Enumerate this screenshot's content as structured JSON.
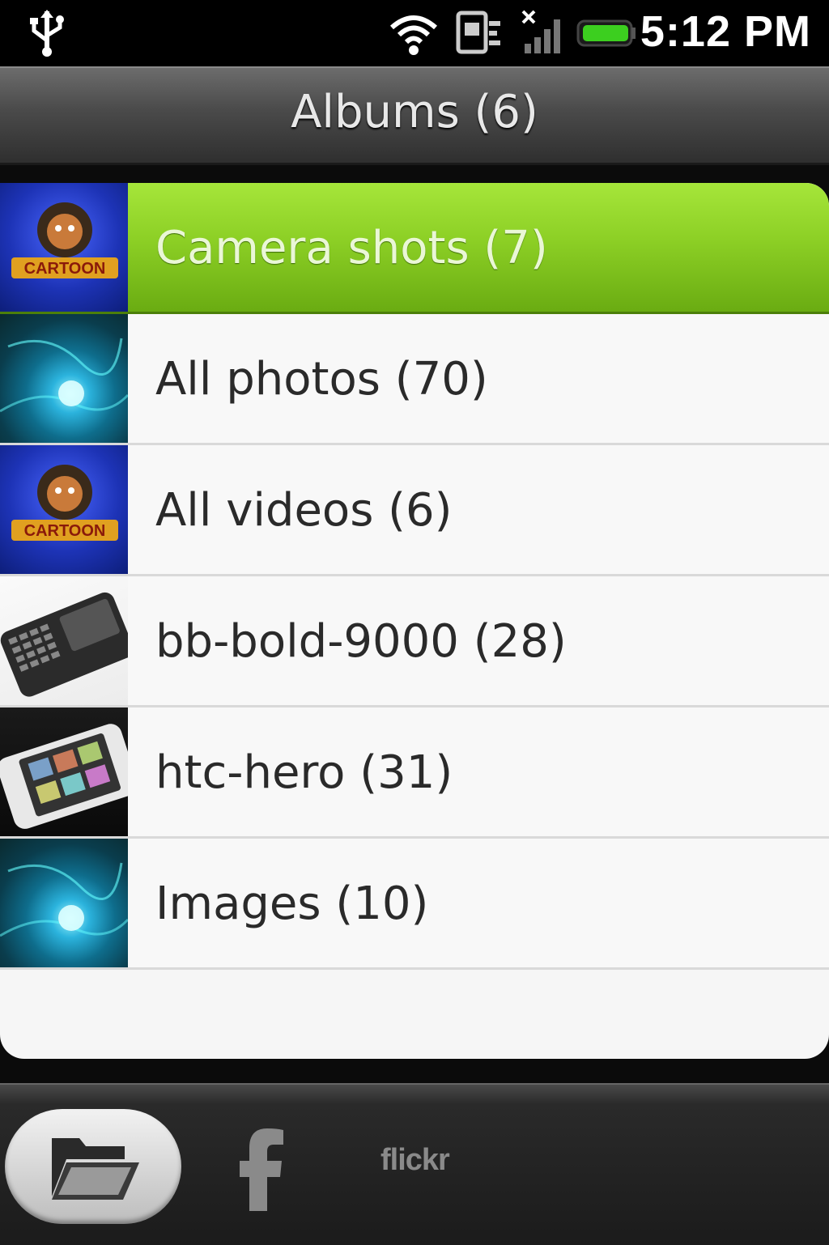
{
  "status_bar": {
    "time": "5:12 PM",
    "icons": [
      "usb-icon",
      "wifi-icon",
      "data-sync-icon",
      "signal-no-service-icon",
      "battery-icon"
    ]
  },
  "header": {
    "title": "Albums (6)"
  },
  "albums": [
    {
      "label": "Camera shots (7)",
      "thumbnail": "cartoon-thumbnail",
      "selected": true
    },
    {
      "label": "All photos (70)",
      "thumbnail": "tech-thumbnail",
      "selected": false
    },
    {
      "label": "All videos (6)",
      "thumbnail": "cartoon-thumbnail",
      "selected": false
    },
    {
      "label": "bb-bold-9000 (28)",
      "thumbnail": "phone-thumbnail",
      "selected": false
    },
    {
      "label": "htc-hero (31)",
      "thumbnail": "phone-thumbnail",
      "selected": false
    },
    {
      "label": "Images (10)",
      "thumbnail": "tech-thumbnail",
      "selected": false
    }
  ],
  "tabs": [
    {
      "name": "albums-tab",
      "icon": "folder-open-icon",
      "active": true
    },
    {
      "name": "facebook-tab",
      "icon": "facebook-icon",
      "active": false
    },
    {
      "name": "flickr-tab",
      "icon": "flickr-icon",
      "label": "flickr",
      "active": false
    }
  ],
  "colors": {
    "selected_green": "#8ccf25",
    "row_bg": "#f8f8f8",
    "title_text": "#e8e8e8"
  }
}
